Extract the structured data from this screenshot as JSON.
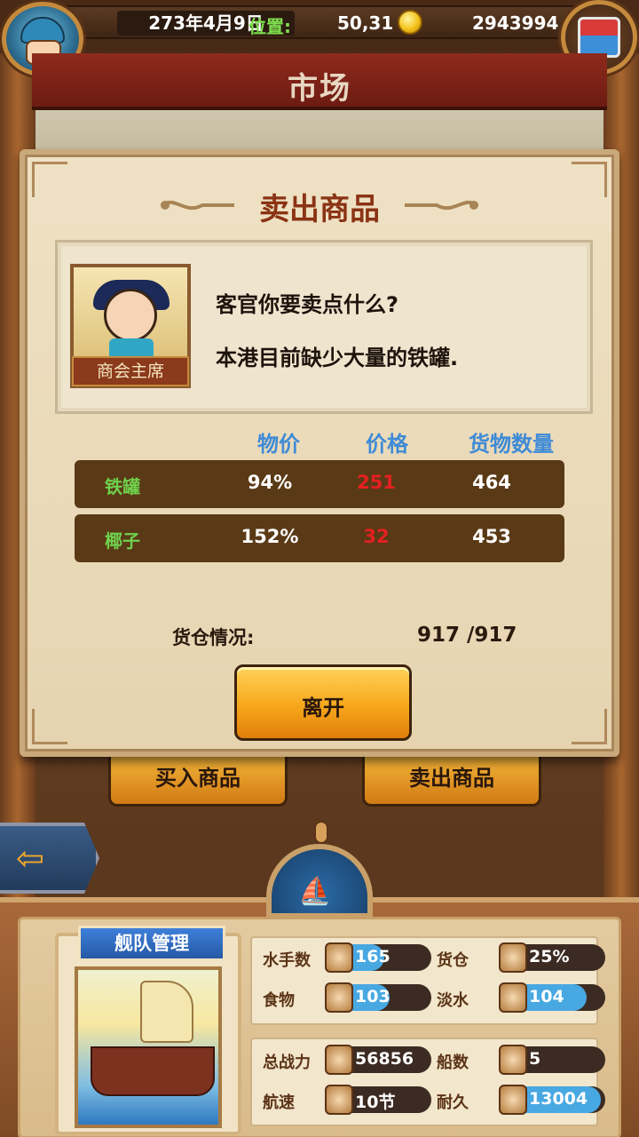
{
  "header": {
    "date": "273年4月9日",
    "position_label": "位置:",
    "position_value": "50,31",
    "gold": "2943994",
    "title": "市场"
  },
  "dialog": {
    "title": "卖出商品",
    "npc_name": "商会主席",
    "npc_line1": "客官你要卖点什么?",
    "npc_line2": "本港目前缺少大量的铁罐.",
    "columns": [
      "物价",
      "价格",
      "货物数量"
    ],
    "rows": [
      {
        "name": "铁罐",
        "pct": "94%",
        "price": "251",
        "qty": "464"
      },
      {
        "name": "椰子",
        "pct": "152%",
        "price": "32",
        "qty": "453"
      }
    ],
    "storage_label": "货仓情况:",
    "storage_value": "917 /917",
    "leave_label": "离开"
  },
  "market_buttons": {
    "buy": "买入商品",
    "sell": "卖出商品"
  },
  "fleet": {
    "label": "舰队管理",
    "stats": [
      {
        "key": "水手数",
        "value": "165",
        "fill": 0.55,
        "icon": "sailor-icon"
      },
      {
        "key": "货仓",
        "value": "25%",
        "fill": 0.25,
        "icon": "cargo-icon"
      },
      {
        "key": "食物",
        "value": "103",
        "fill": 0.6,
        "icon": "meat-icon"
      },
      {
        "key": "淡水",
        "value": "104",
        "fill": 0.82,
        "icon": "water-icon"
      },
      {
        "key": "总战力",
        "value": "56856",
        "fill": 0,
        "icon": "crossed-swords-icon"
      },
      {
        "key": "船数",
        "value": "5",
        "fill": 0,
        "icon": "ship-count-icon"
      },
      {
        "key": "航速",
        "value": "10节",
        "fill": 0,
        "icon": "sailing-speed-icon"
      },
      {
        "key": "耐久",
        "value": "13004",
        "fill": 0.96,
        "icon": "durability-icon"
      }
    ]
  }
}
